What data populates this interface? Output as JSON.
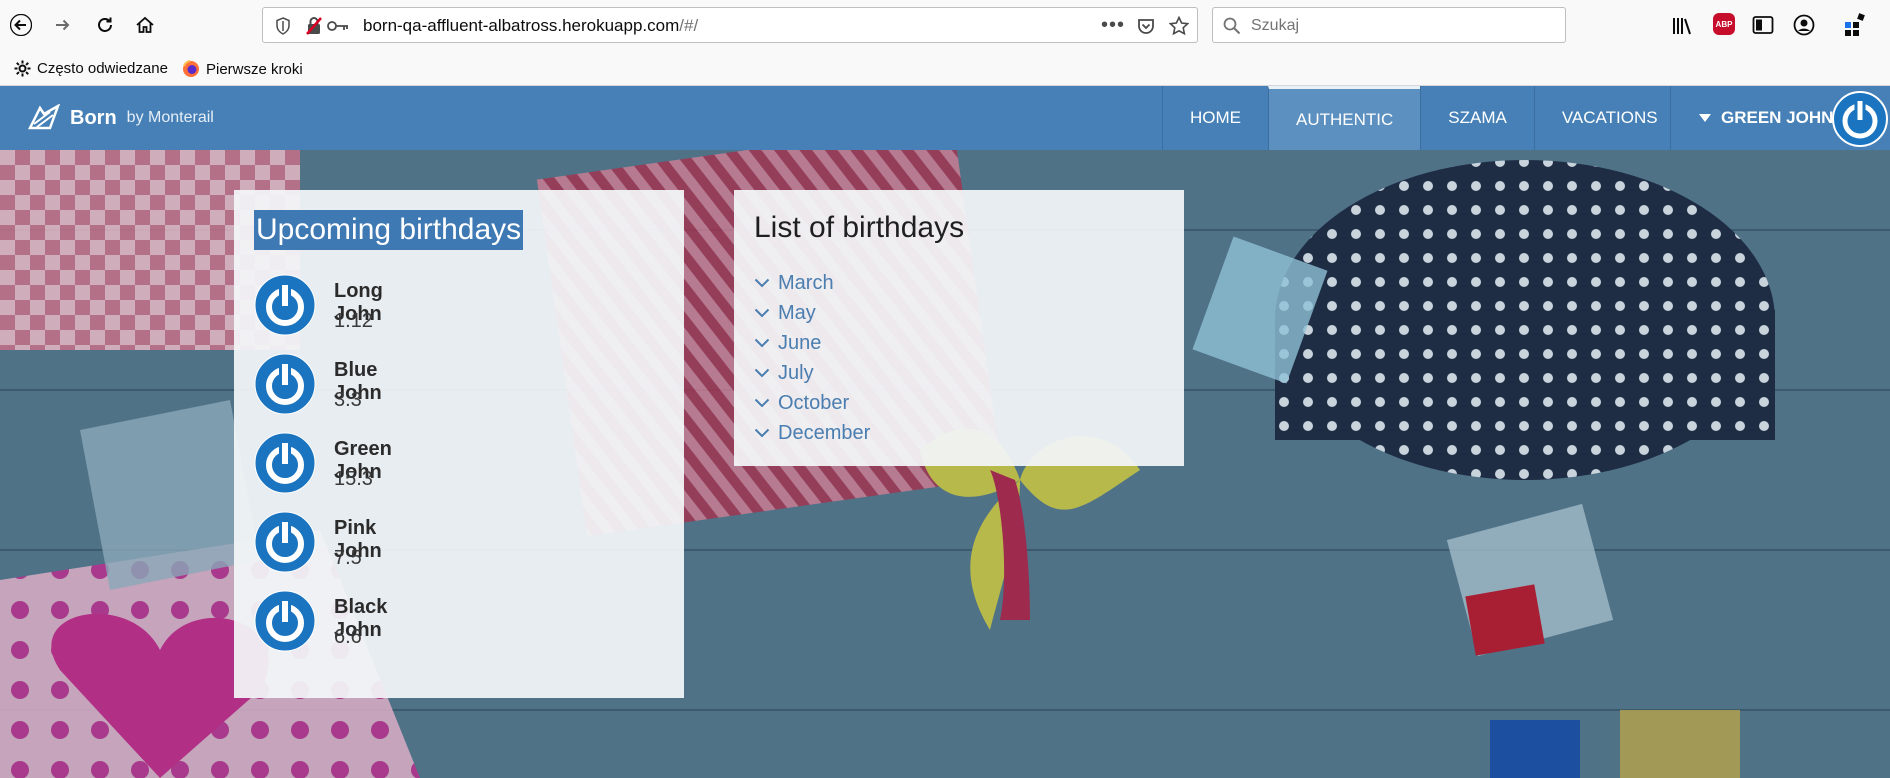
{
  "browser": {
    "url_host": "born-qa-affluent-albatross.herokuapp.com",
    "url_path": "/#/",
    "search_placeholder": "Szukaj",
    "bookmarks": [
      "Często odwiedzane",
      "Pierwsze kroki"
    ],
    "abp_label": "ABP"
  },
  "app": {
    "brand_name": "Born",
    "brand_by": "by Monterail",
    "nav": [
      "HOME",
      "AUTHENTIC",
      "SZAMA",
      "VACATIONS"
    ],
    "active_nav": "AUTHENTIC",
    "user_name": "GREEN JOHN"
  },
  "upcoming": {
    "title": "Upcoming birthdays",
    "items": [
      {
        "name": "Long John",
        "date": "1.12"
      },
      {
        "name": "Blue John",
        "date": "3.3"
      },
      {
        "name": "Green John",
        "date": "15.3"
      },
      {
        "name": "Pink John",
        "date": "7.5"
      },
      {
        "name": "Black John",
        "date": "6.6"
      }
    ]
  },
  "list": {
    "title": "List of birthdays",
    "months": [
      "March",
      "May",
      "June",
      "July",
      "October",
      "December"
    ]
  },
  "colors": {
    "header": "#4680b6",
    "accent": "#1a74bf",
    "link": "#4a7db0"
  }
}
